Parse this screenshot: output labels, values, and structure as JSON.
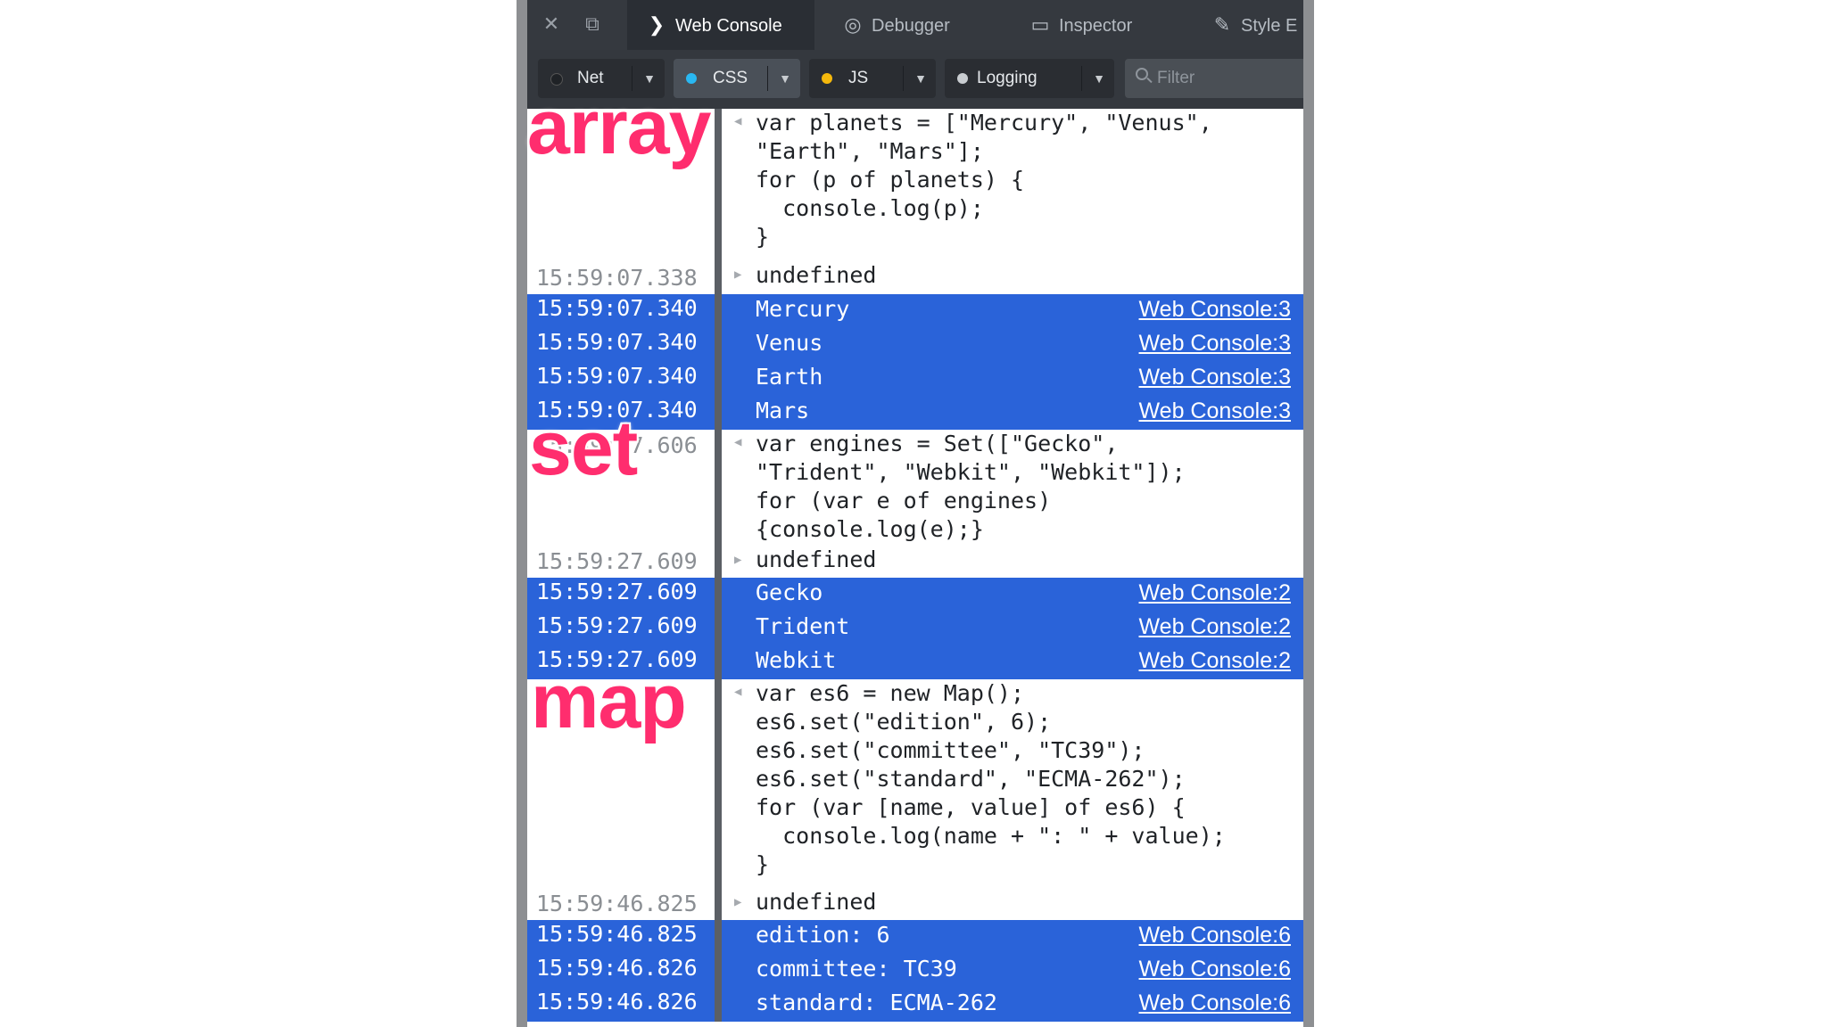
{
  "toolbar": {
    "close_icon": "close-icon",
    "detach_icon": "detach-icon",
    "tabs": [
      {
        "label": "Web Console",
        "icon": "console-chevron-icon"
      },
      {
        "label": "Debugger",
        "icon": "debugger-icon"
      },
      {
        "label": "Inspector",
        "icon": "inspector-icon"
      },
      {
        "label": "Style E",
        "icon": "style-editor-icon"
      }
    ]
  },
  "filters": {
    "net": {
      "label": "Net",
      "color": "#2a2d32"
    },
    "css": {
      "label": "CSS",
      "color": "#29b8f2"
    },
    "js": {
      "label": "JS",
      "color": "#f5b80c"
    },
    "logging": {
      "label": "Logging",
      "color": "#c8ccd0"
    },
    "search_placeholder": "Filter"
  },
  "annotations": {
    "array": "array",
    "set": "set",
    "map": "map"
  },
  "colors": {
    "highlight": "#2a63d9",
    "annotation": "#ff2d6e"
  },
  "console": {
    "block1": {
      "code": "var planets = [\"Mercury\", \"Venus\",\n\"Earth\", \"Mars\"];\nfor (p of planets) {\n  console.log(p);\n}",
      "result_ts": "15:59:07.338",
      "result": "undefined",
      "logs": [
        {
          "ts": "15:59:07.340",
          "text": "Mercury",
          "loc": "Web Console:3"
        },
        {
          "ts": "15:59:07.340",
          "text": "Venus",
          "loc": "Web Console:3"
        },
        {
          "ts": "15:59:07.340",
          "text": "Earth",
          "loc": "Web Console:3"
        },
        {
          "ts": "15:59:07.340",
          "text": "Mars",
          "loc": "Web Console:3"
        }
      ]
    },
    "block2": {
      "input_ts": "15:59:27.606",
      "code": "var engines = Set([\"Gecko\",\n\"Trident\", \"Webkit\", \"Webkit\"]);\nfor (var e of engines)\n{console.log(e);}",
      "result_ts": "15:59:27.609",
      "result": "undefined",
      "logs": [
        {
          "ts": "15:59:27.609",
          "text": "Gecko",
          "loc": "Web Console:2"
        },
        {
          "ts": "15:59:27.609",
          "text": "Trident",
          "loc": "Web Console:2"
        },
        {
          "ts": "15:59:27.609",
          "text": "Webkit",
          "loc": "Web Console:2"
        }
      ]
    },
    "block3": {
      "code": "var es6 = new Map();\nes6.set(\"edition\", 6);\nes6.set(\"committee\", \"TC39\");\nes6.set(\"standard\", \"ECMA-262\");\nfor (var [name, value] of es6) {\n  console.log(name + \": \" + value);\n}",
      "result_ts": "15:59:46.825",
      "result": "undefined",
      "logs": [
        {
          "ts": "15:59:46.825",
          "text": "edition: 6",
          "loc": "Web Console:6"
        },
        {
          "ts": "15:59:46.826",
          "text": "committee: TC39",
          "loc": "Web Console:6"
        },
        {
          "ts": "15:59:46.826",
          "text": "standard: ECMA-262",
          "loc": "Web Console:6"
        }
      ]
    }
  }
}
